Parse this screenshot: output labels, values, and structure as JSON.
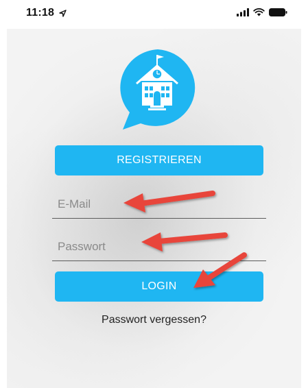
{
  "status_bar": {
    "time": "11:18",
    "icons": [
      "location-arrow-icon",
      "signal-icon",
      "wifi-icon",
      "battery-icon"
    ]
  },
  "logo": {
    "icon": "school-chat-bubble-icon",
    "color": "#1fb6f2"
  },
  "buttons": {
    "register_label": "REGISTRIEREN",
    "login_label": "LOGIN"
  },
  "fields": {
    "email_placeholder": "E-Mail",
    "password_placeholder": "Passwort"
  },
  "links": {
    "forgot_password": "Passwort vergessen?"
  },
  "annotations": {
    "arrow_color": "#e8443a",
    "arrow_targets": [
      "email-field",
      "password-field",
      "login-button"
    ]
  },
  "colors": {
    "accent": "#1fb6f2",
    "button_text": "#ffffff"
  }
}
